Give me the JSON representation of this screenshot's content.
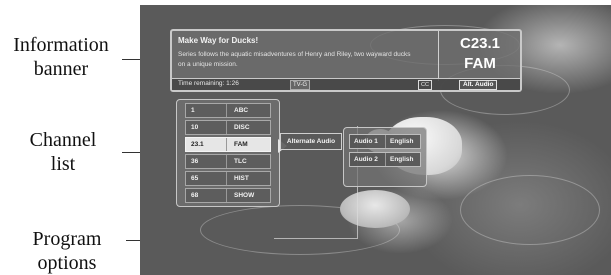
{
  "annotations": {
    "info_banner": [
      "Information",
      "banner"
    ],
    "channel_list": [
      "Channel",
      "list"
    ],
    "program_options": [
      "Program",
      "options"
    ]
  },
  "banner": {
    "title": "Make Way for Ducks!",
    "description": "Series follows the aquatic misadventures of Henry and Riley, two wayward ducks on a unique mission.",
    "channel_number": "C23.1",
    "network": "FAM",
    "time_remaining": "Time remaining: 1:26",
    "rating": "TV-G",
    "cc": "CC",
    "alt_audio": "Alt. Audio"
  },
  "channels": [
    {
      "number": "1",
      "call": "ABC",
      "selected": false
    },
    {
      "number": "10",
      "call": "DISC",
      "selected": false
    },
    {
      "number": "23.1",
      "call": "FAM",
      "selected": true
    },
    {
      "number": "36",
      "call": "TLC",
      "selected": false
    },
    {
      "number": "65",
      "call": "HIST",
      "selected": false
    },
    {
      "number": "68",
      "call": "SHOW",
      "selected": false
    }
  ],
  "program_options": {
    "alternate_audio_label": "Alternate Audio",
    "audio_tracks": [
      {
        "label": "Audio 1",
        "language": "English",
        "selected": true
      },
      {
        "label": "Audio 2",
        "language": "English",
        "selected": false
      }
    ]
  }
}
